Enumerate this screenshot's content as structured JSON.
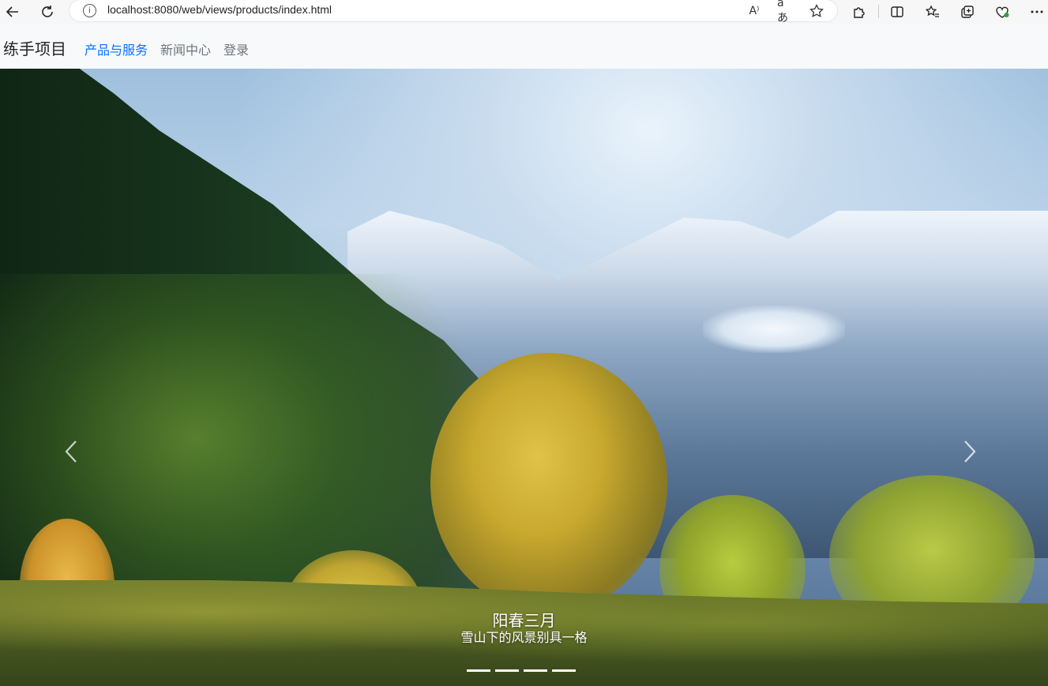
{
  "browser": {
    "url": "localhost:8080/web/views/products/index.html",
    "info_glyph": "i",
    "read_aloud_glyph": "A⁾",
    "translate_glyph": "aあ"
  },
  "navbar": {
    "brand": "练手项目",
    "links": [
      {
        "label": "产品与服务",
        "active": true
      },
      {
        "label": "新闻中心",
        "active": false
      },
      {
        "label": "登录",
        "active": false
      }
    ]
  },
  "carousel": {
    "slide": {
      "title": "阳春三月",
      "text": "雪山下的风景别具一格"
    },
    "indicator_count": 4
  },
  "colors": {
    "active_link": "#0d6efd",
    "link": "#6c757d",
    "navbar_bg": "#f8f9fa"
  }
}
